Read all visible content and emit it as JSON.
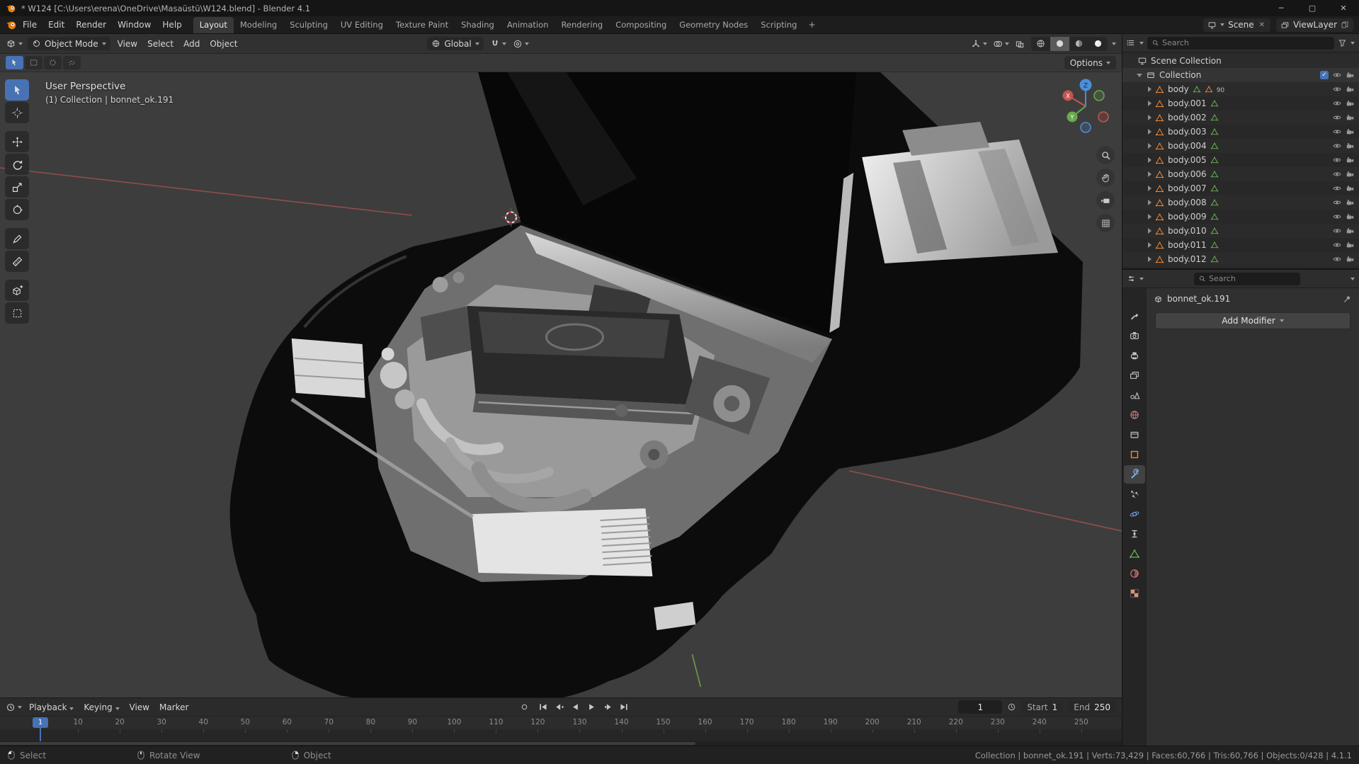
{
  "titlebar": {
    "title": "* W124 [C:\\Users\\erena\\OneDrive\\Masaüstü\\W124.blend] - Blender 4.1"
  },
  "topbar": {
    "menus": [
      "File",
      "Edit",
      "Render",
      "Window",
      "Help"
    ],
    "workspaces": [
      "Layout",
      "Modeling",
      "Sculpting",
      "UV Editing",
      "Texture Paint",
      "Shading",
      "Animation",
      "Rendering",
      "Compositing",
      "Geometry Nodes",
      "Scripting"
    ],
    "active_workspace": "Layout",
    "add_workspace": "+",
    "scene_name": "Scene",
    "viewlayer_name": "ViewLayer"
  },
  "viewport_header": {
    "mode": "Object Mode",
    "menus": [
      "View",
      "Select",
      "Add",
      "Object"
    ],
    "orientation": "Global"
  },
  "tool_settings": {
    "select_modes": [
      "tweak",
      "box",
      "circle",
      "lasso"
    ],
    "options_label": "Options"
  },
  "toolbar": {
    "tools": [
      "select-box",
      "cursor",
      "move",
      "rotate",
      "scale",
      "transform",
      "annotate",
      "measure",
      "add-cube",
      "interact"
    ]
  },
  "viewport": {
    "perspective_label": "User Perspective",
    "context_label": "(1) Collection | bonnet_ok.191",
    "gizmo": {
      "x": "X",
      "y": "Y",
      "z": "Z"
    },
    "nav_buttons": [
      "zoom",
      "pan",
      "camera",
      "ortho"
    ]
  },
  "outliner": {
    "search_placeholder": "Search",
    "scene_collection_label": "Scene Collection",
    "collection_label": "Collection",
    "objects": [
      "body",
      "body.001",
      "body.002",
      "body.003",
      "body.004",
      "body.005",
      "body.006",
      "body.007",
      "body.008",
      "body.009",
      "body.010",
      "body.011",
      "body.012"
    ],
    "first_object_badge": "90"
  },
  "properties": {
    "search_placeholder": "Search",
    "pinned_object": "bonnet_ok.191",
    "add_modifier_label": "Add Modifier",
    "tabs": [
      "tool",
      "render",
      "output",
      "view-layer",
      "scene",
      "world",
      "collection",
      "object",
      "modifiers",
      "particles",
      "physics",
      "constraints",
      "data",
      "material",
      "texture"
    ],
    "active_tab": "modifiers"
  },
  "timeline": {
    "menus": [
      "Playback",
      "Keying",
      "View",
      "Marker"
    ],
    "transport_buttons": [
      "jump-start",
      "prev-keyframe",
      "play-reverse",
      "play",
      "next-keyframe",
      "jump-end"
    ],
    "current_frame": "1",
    "start_label": "Start",
    "start_value": "1",
    "end_label": "End",
    "end_value": "250",
    "ruler_ticks": [
      10,
      20,
      30,
      40,
      50,
      60,
      70,
      80,
      90,
      100,
      110,
      120,
      130,
      140,
      150,
      160,
      170,
      180,
      190,
      200,
      210,
      220,
      230,
      240,
      250
    ],
    "playhead_frame": "1"
  },
  "statusbar": {
    "hints": [
      "Select",
      "Rotate View",
      "Object"
    ],
    "stats": "Collection | bonnet_ok.191 | Verts:73,429 | Faces:60,766 | Tris:60,766 | Objects:0/428 | 4.1.1"
  },
  "colors": {
    "accent": "#4772b3",
    "object_orange": "#e8883a",
    "data_green": "#69b351"
  }
}
